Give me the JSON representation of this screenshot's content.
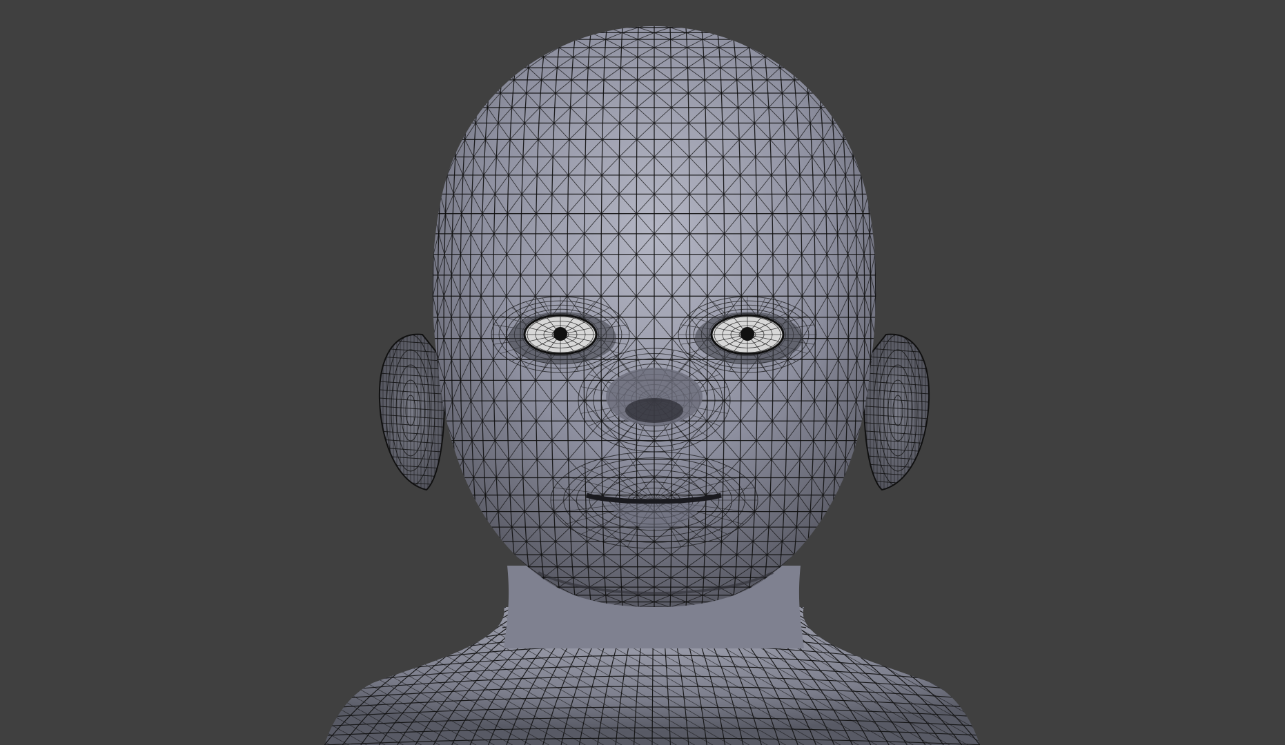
{
  "viewport": {
    "background_color": "#404040",
    "mesh_fill_color": "#8e90a0",
    "mesh_highlight_color": "#b4b6c4",
    "mesh_shadow_color": "#5a5b66",
    "wire_color": "#101010",
    "eye_white_color": "#d8d8d8"
  }
}
